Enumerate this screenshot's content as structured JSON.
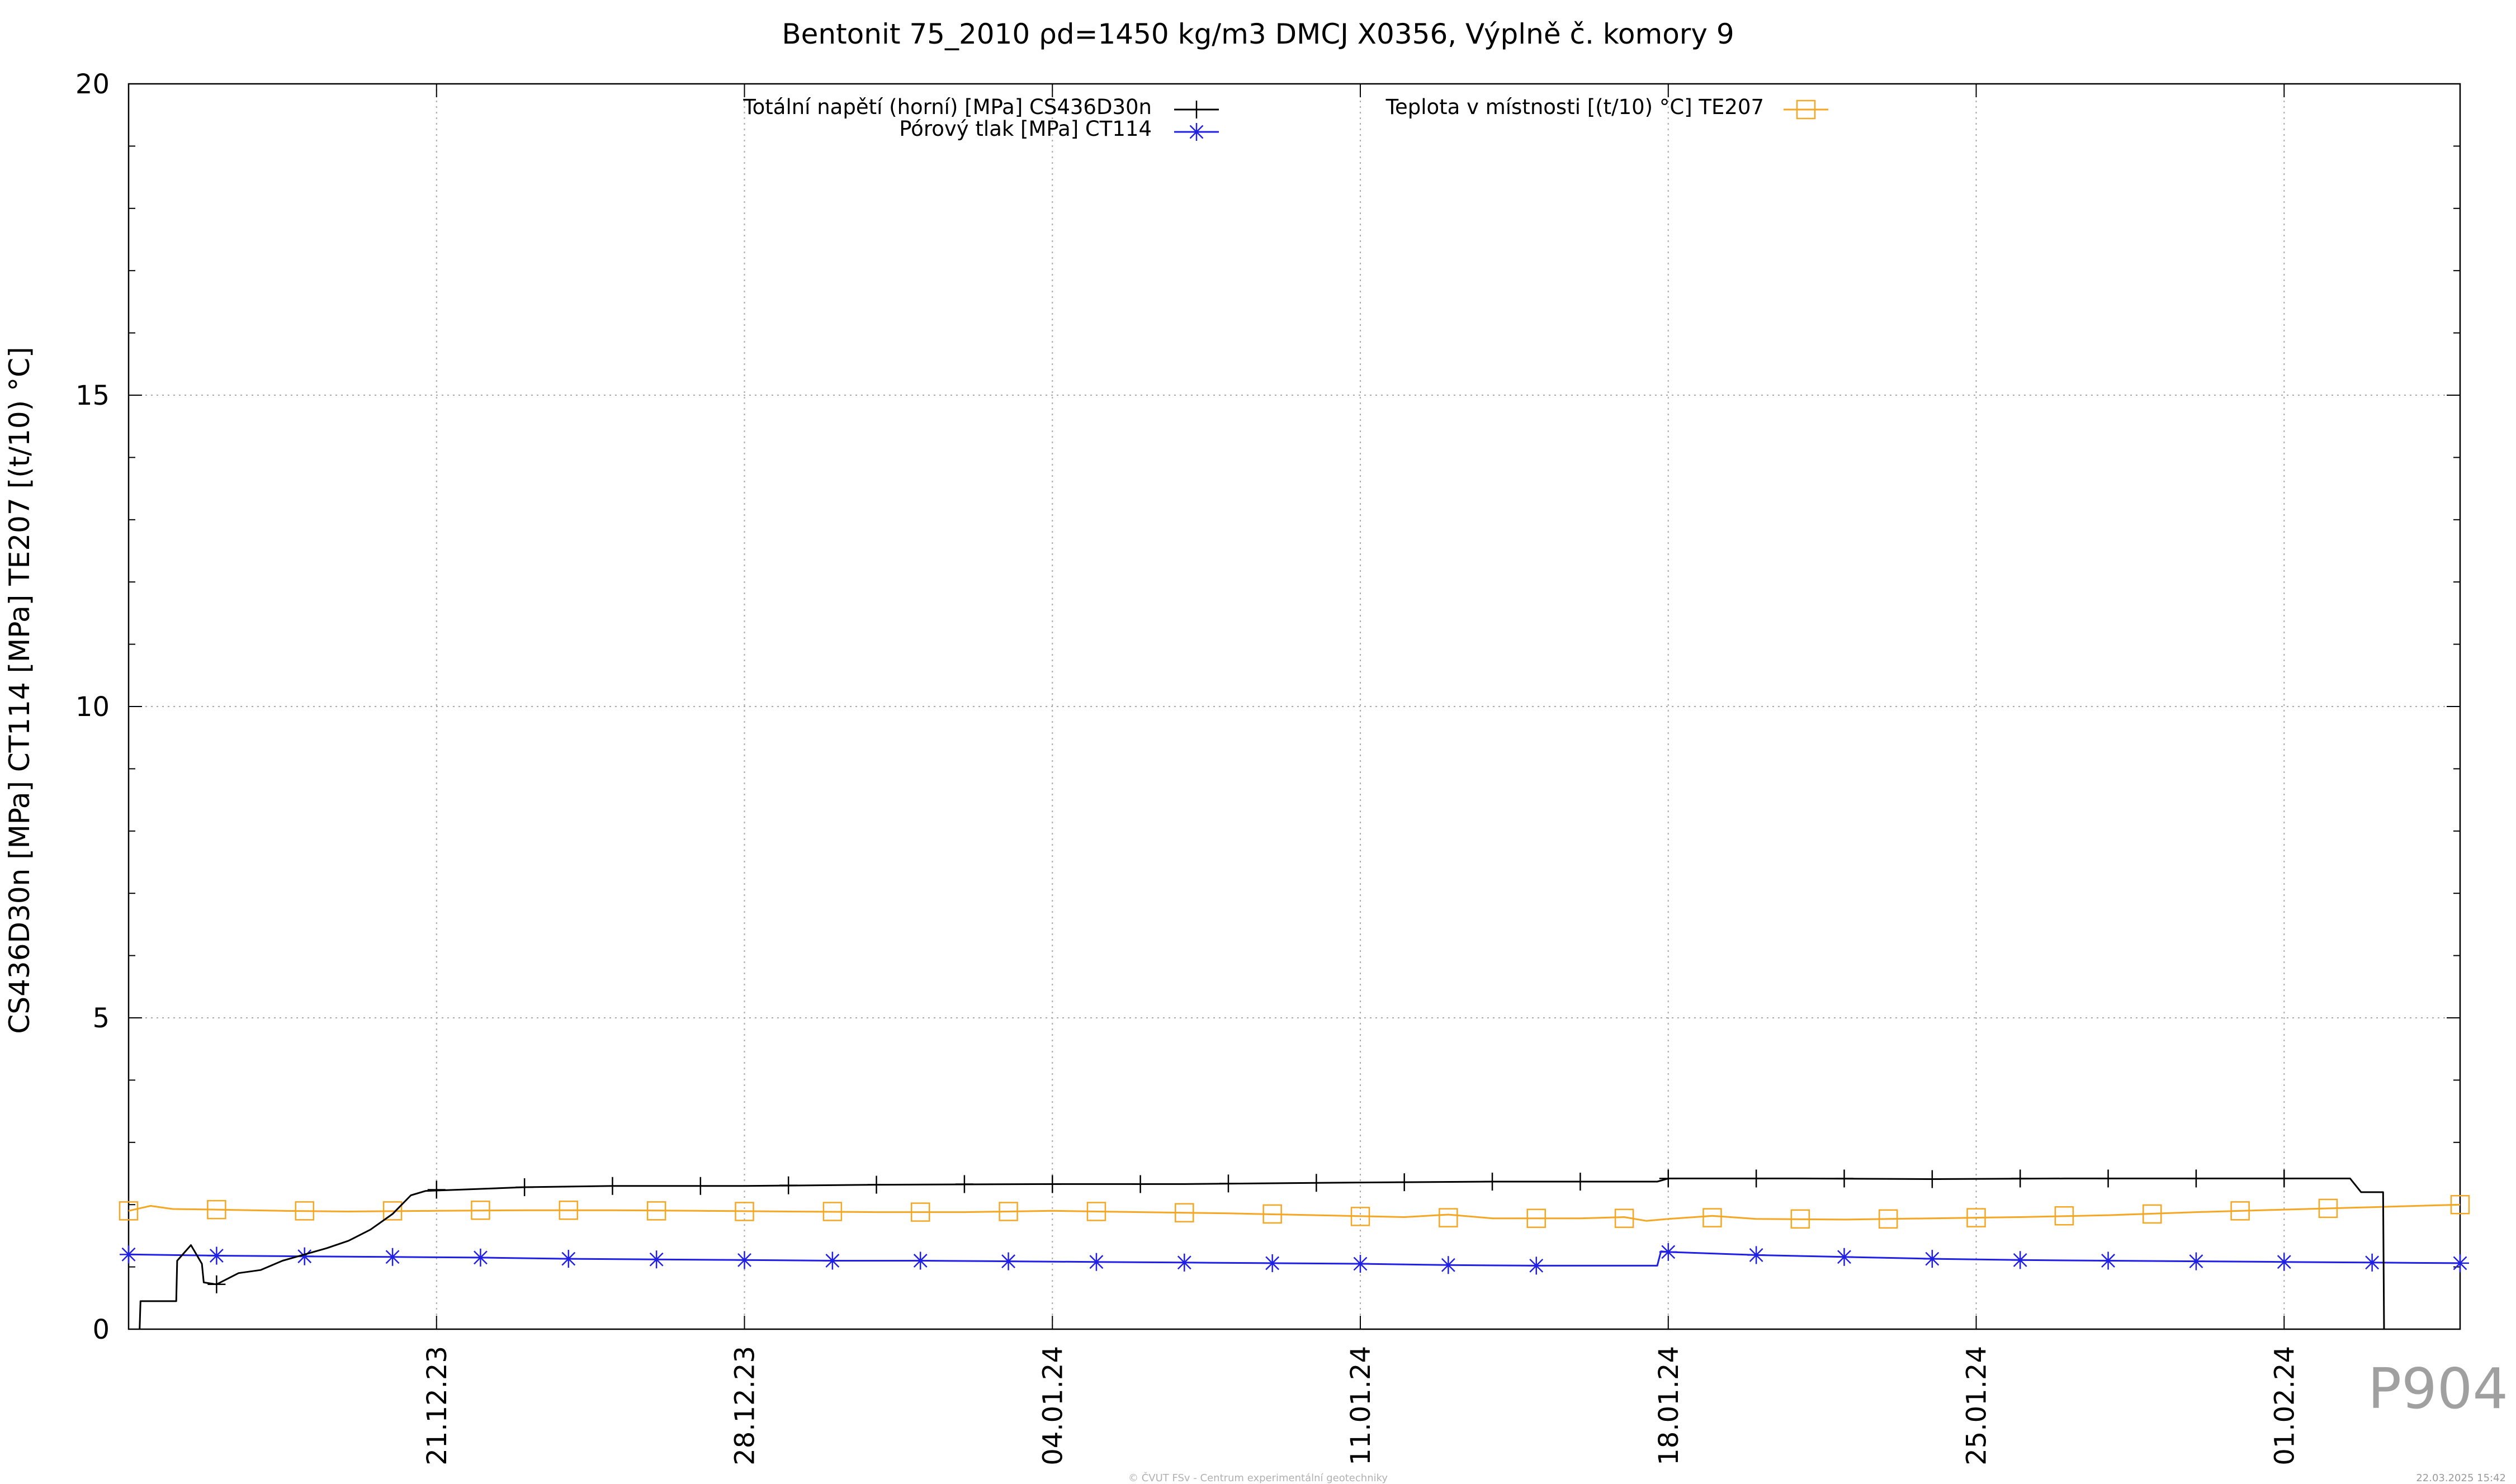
{
  "chart_data": {
    "type": "line",
    "title": "Bentonit 75_2010 ρd=1450 kg/m3 DMCJ X0356, Výplně č. komory 9",
    "ylabel": "CS436D30n [MPa] CT114 [MPa] TE207 [(t/10) °C]",
    "xlabel": "",
    "ylim": [
      0,
      20
    ],
    "yticks": [
      "0",
      "5",
      "10",
      "15",
      "20"
    ],
    "xlim": [
      "2023-12-14",
      "2024-02-05"
    ],
    "xticks": [
      {
        "date": "2023-12-21",
        "label": "21.12.23"
      },
      {
        "date": "2023-12-28",
        "label": "28.12.23"
      },
      {
        "date": "2024-01-04",
        "label": "04.01.24"
      },
      {
        "date": "2024-01-11",
        "label": "11.01.24"
      },
      {
        "date": "2024-01-18",
        "label": "18.01.24"
      },
      {
        "date": "2024-01-25",
        "label": "25.01.24"
      },
      {
        "date": "2024-02-01",
        "label": "01.02.24"
      }
    ],
    "grid": true,
    "legend": "top",
    "series": [
      {
        "name": "Totální napětí (horní) [MPa] CS436D30n",
        "color": "#000000",
        "marker": "plus",
        "points": [
          [
            "2023-12-14T06:00",
            0.0
          ],
          [
            "2023-12-14T06:30",
            0.45
          ],
          [
            "2023-12-15T02:00",
            0.45
          ],
          [
            "2023-12-15T02:30",
            1.1
          ],
          [
            "2023-12-15T10:00",
            1.35
          ],
          [
            "2023-12-15T16:00",
            1.05
          ],
          [
            "2023-12-15T17:00",
            0.75
          ],
          [
            "2023-12-16T00:00",
            0.72
          ],
          [
            "2023-12-16T12:00",
            0.9
          ],
          [
            "2023-12-17T00:00",
            0.95
          ],
          [
            "2023-12-17T12:00",
            1.1
          ],
          [
            "2023-12-18T00:00",
            1.2
          ],
          [
            "2023-12-18T12:00",
            1.3
          ],
          [
            "2023-12-19T00:00",
            1.42
          ],
          [
            "2023-12-19T12:00",
            1.6
          ],
          [
            "2023-12-20T00:00",
            1.85
          ],
          [
            "2023-12-20T10:00",
            2.15
          ],
          [
            "2023-12-20T18:00",
            2.22
          ],
          [
            "2023-12-21T12:00",
            2.24
          ],
          [
            "2023-12-23T00:00",
            2.28
          ],
          [
            "2023-12-25T00:00",
            2.3
          ],
          [
            "2023-12-28T00:00",
            2.3
          ],
          [
            "2023-12-31T00:00",
            2.32
          ],
          [
            "2024-01-04T00:00",
            2.33
          ],
          [
            "2024-01-07T00:00",
            2.33
          ],
          [
            "2024-01-10T00:00",
            2.35
          ],
          [
            "2024-01-14T00:00",
            2.37
          ],
          [
            "2024-01-17T18:00",
            2.37
          ],
          [
            "2024-01-18T00:00",
            2.42
          ],
          [
            "2024-01-21T00:00",
            2.42
          ],
          [
            "2024-01-24T00:00",
            2.41
          ],
          [
            "2024-01-27T00:00",
            2.42
          ],
          [
            "2024-01-30T00:00",
            2.42
          ],
          [
            "2024-02-02T12:00",
            2.42
          ],
          [
            "2024-02-02T18:00",
            2.2
          ],
          [
            "2024-02-03T06:00",
            2.2
          ],
          [
            "2024-02-03T06:30",
            0.0
          ]
        ],
        "markers": [
          [
            "2023-12-16T00:00",
            0.72
          ],
          [
            "2023-12-21T00:00",
            2.24
          ],
          [
            "2023-12-23T00:00",
            2.28
          ],
          [
            "2023-12-25T00:00",
            2.3
          ],
          [
            "2023-12-27T00:00",
            2.3
          ],
          [
            "2023-12-29T00:00",
            2.31
          ],
          [
            "2023-12-31T00:00",
            2.32
          ],
          [
            "2024-01-02T00:00",
            2.33
          ],
          [
            "2024-01-04T00:00",
            2.33
          ],
          [
            "2024-01-06T00:00",
            2.33
          ],
          [
            "2024-01-08T00:00",
            2.34
          ],
          [
            "2024-01-10T00:00",
            2.35
          ],
          [
            "2024-01-12T00:00",
            2.36
          ],
          [
            "2024-01-14T00:00",
            2.37
          ],
          [
            "2024-01-16T00:00",
            2.37
          ],
          [
            "2024-01-18T00:00",
            2.42
          ],
          [
            "2024-01-20T00:00",
            2.42
          ],
          [
            "2024-01-22T00:00",
            2.42
          ],
          [
            "2024-01-24T00:00",
            2.41
          ],
          [
            "2024-01-26T00:00",
            2.42
          ],
          [
            "2024-01-28T00:00",
            2.42
          ],
          [
            "2024-01-30T00:00",
            2.42
          ],
          [
            "2024-02-01T00:00",
            2.42
          ]
        ]
      },
      {
        "name": "Pórový tlak [MPa] CT114",
        "color": "#1f1fe6",
        "marker": "star",
        "points": [
          [
            "2023-12-14T00:00",
            1.2
          ],
          [
            "2023-12-16T00:00",
            1.18
          ],
          [
            "2023-12-18T00:00",
            1.17
          ],
          [
            "2023-12-20T00:00",
            1.16
          ],
          [
            "2023-12-22T00:00",
            1.15
          ],
          [
            "2023-12-24T00:00",
            1.13
          ],
          [
            "2023-12-26T00:00",
            1.12
          ],
          [
            "2023-12-28T00:00",
            1.11
          ],
          [
            "2023-12-30T00:00",
            1.1
          ],
          [
            "2024-01-01T00:00",
            1.1
          ],
          [
            "2024-01-03T00:00",
            1.09
          ],
          [
            "2024-01-05T00:00",
            1.08
          ],
          [
            "2024-01-07T00:00",
            1.07
          ],
          [
            "2024-01-09T00:00",
            1.06
          ],
          [
            "2024-01-11T00:00",
            1.05
          ],
          [
            "2024-01-13T00:00",
            1.03
          ],
          [
            "2024-01-15T00:00",
            1.02
          ],
          [
            "2024-01-17T00:00",
            1.02
          ],
          [
            "2024-01-17T18:00",
            1.02
          ],
          [
            "2024-01-17T20:00",
            1.25
          ],
          [
            "2024-01-18T00:00",
            1.24
          ],
          [
            "2024-01-20T00:00",
            1.19
          ],
          [
            "2024-01-22T00:00",
            1.16
          ],
          [
            "2024-01-24T00:00",
            1.13
          ],
          [
            "2024-01-26T00:00",
            1.11
          ],
          [
            "2024-01-28T00:00",
            1.1
          ],
          [
            "2024-01-30T00:00",
            1.09
          ],
          [
            "2024-02-01T00:00",
            1.08
          ],
          [
            "2024-02-03T00:00",
            1.07
          ],
          [
            "2024-02-05T00:00",
            1.06
          ]
        ],
        "markers": [
          [
            "2023-12-14T00:00",
            1.2
          ],
          [
            "2023-12-16T00:00",
            1.18
          ],
          [
            "2023-12-18T00:00",
            1.17
          ],
          [
            "2023-12-20T00:00",
            1.16
          ],
          [
            "2023-12-22T00:00",
            1.15
          ],
          [
            "2023-12-24T00:00",
            1.13
          ],
          [
            "2023-12-26T00:00",
            1.12
          ],
          [
            "2023-12-28T00:00",
            1.11
          ],
          [
            "2023-12-30T00:00",
            1.1
          ],
          [
            "2024-01-01T00:00",
            1.1
          ],
          [
            "2024-01-03T00:00",
            1.09
          ],
          [
            "2024-01-05T00:00",
            1.08
          ],
          [
            "2024-01-07T00:00",
            1.07
          ],
          [
            "2024-01-09T00:00",
            1.06
          ],
          [
            "2024-01-11T00:00",
            1.05
          ],
          [
            "2024-01-13T00:00",
            1.03
          ],
          [
            "2024-01-15T00:00",
            1.02
          ],
          [
            "2024-01-18T00:00",
            1.24
          ],
          [
            "2024-01-20T00:00",
            1.19
          ],
          [
            "2024-01-22T00:00",
            1.16
          ],
          [
            "2024-01-24T00:00",
            1.13
          ],
          [
            "2024-01-26T00:00",
            1.11
          ],
          [
            "2024-01-28T00:00",
            1.1
          ],
          [
            "2024-01-30T00:00",
            1.09
          ],
          [
            "2024-02-01T00:00",
            1.08
          ],
          [
            "2024-02-03T00:00",
            1.07
          ],
          [
            "2024-02-05T00:00",
            1.06
          ]
        ]
      },
      {
        "name": "Teplota v místnosti [(t/10) °C] TE207",
        "color": "#f5a623",
        "marker": "square",
        "points": [
          [
            "2023-12-14T00:00",
            1.9
          ],
          [
            "2023-12-14T12:00",
            1.98
          ],
          [
            "2023-12-15T00:00",
            1.93
          ],
          [
            "2023-12-16T00:00",
            1.92
          ],
          [
            "2023-12-17T12:00",
            1.9
          ],
          [
            "2023-12-19T00:00",
            1.89
          ],
          [
            "2023-12-21T00:00",
            1.9
          ],
          [
            "2023-12-23T00:00",
            1.91
          ],
          [
            "2023-12-25T00:00",
            1.91
          ],
          [
            "2023-12-27T00:00",
            1.9
          ],
          [
            "2023-12-29T00:00",
            1.89
          ],
          [
            "2023-12-31T00:00",
            1.88
          ],
          [
            "2024-01-02T00:00",
            1.88
          ],
          [
            "2024-01-04T00:00",
            1.9
          ],
          [
            "2024-01-06T00:00",
            1.88
          ],
          [
            "2024-01-08T00:00",
            1.86
          ],
          [
            "2024-01-10T00:00",
            1.83
          ],
          [
            "2024-01-12T00:00",
            1.8
          ],
          [
            "2024-01-13T00:00",
            1.84
          ],
          [
            "2024-01-14T00:00",
            1.78
          ],
          [
            "2024-01-16T00:00",
            1.78
          ],
          [
            "2024-01-17T00:00",
            1.8
          ],
          [
            "2024-01-17T12:00",
            1.74
          ],
          [
            "2024-01-18T00:00",
            1.77
          ],
          [
            "2024-01-19T00:00",
            1.82
          ],
          [
            "2024-01-20T00:00",
            1.77
          ],
          [
            "2024-01-22T00:00",
            1.76
          ],
          [
            "2024-01-24T00:00",
            1.78
          ],
          [
            "2024-01-26T00:00",
            1.8
          ],
          [
            "2024-01-28T00:00",
            1.83
          ],
          [
            "2024-01-30T00:00",
            1.88
          ],
          [
            "2024-02-01T00:00",
            1.92
          ],
          [
            "2024-02-03T00:00",
            1.96
          ],
          [
            "2024-02-05T00:00",
            2.0
          ]
        ],
        "markers": [
          [
            "2023-12-14T00:00",
            1.9
          ],
          [
            "2023-12-16T00:00",
            1.92
          ],
          [
            "2023-12-18T00:00",
            1.9
          ],
          [
            "2023-12-20T00:00",
            1.9
          ],
          [
            "2023-12-22T00:00",
            1.91
          ],
          [
            "2023-12-24T00:00",
            1.91
          ],
          [
            "2023-12-26T00:00",
            1.9
          ],
          [
            "2023-12-28T00:00",
            1.89
          ],
          [
            "2023-12-30T00:00",
            1.89
          ],
          [
            "2024-01-01T00:00",
            1.88
          ],
          [
            "2024-01-03T00:00",
            1.89
          ],
          [
            "2024-01-05T00:00",
            1.89
          ],
          [
            "2024-01-07T00:00",
            1.87
          ],
          [
            "2024-01-09T00:00",
            1.85
          ],
          [
            "2024-01-11T00:00",
            1.81
          ],
          [
            "2024-01-13T00:00",
            1.79
          ],
          [
            "2024-01-15T00:00",
            1.78
          ],
          [
            "2024-01-17T00:00",
            1.78
          ],
          [
            "2024-01-19T00:00",
            1.79
          ],
          [
            "2024-01-21T00:00",
            1.77
          ],
          [
            "2024-01-23T00:00",
            1.77
          ],
          [
            "2024-01-25T00:00",
            1.79
          ],
          [
            "2024-01-27T00:00",
            1.82
          ],
          [
            "2024-01-29T00:00",
            1.85
          ],
          [
            "2024-01-31T00:00",
            1.9
          ],
          [
            "2024-02-02T00:00",
            1.94
          ],
          [
            "2024-02-05T00:00",
            2.0
          ]
        ]
      }
    ]
  },
  "footer": {
    "credit": "© ČVUT FSv - Centrum experimentální geotechniky",
    "timestamp": "22.03.2025 15:42",
    "page_id": "P904"
  }
}
